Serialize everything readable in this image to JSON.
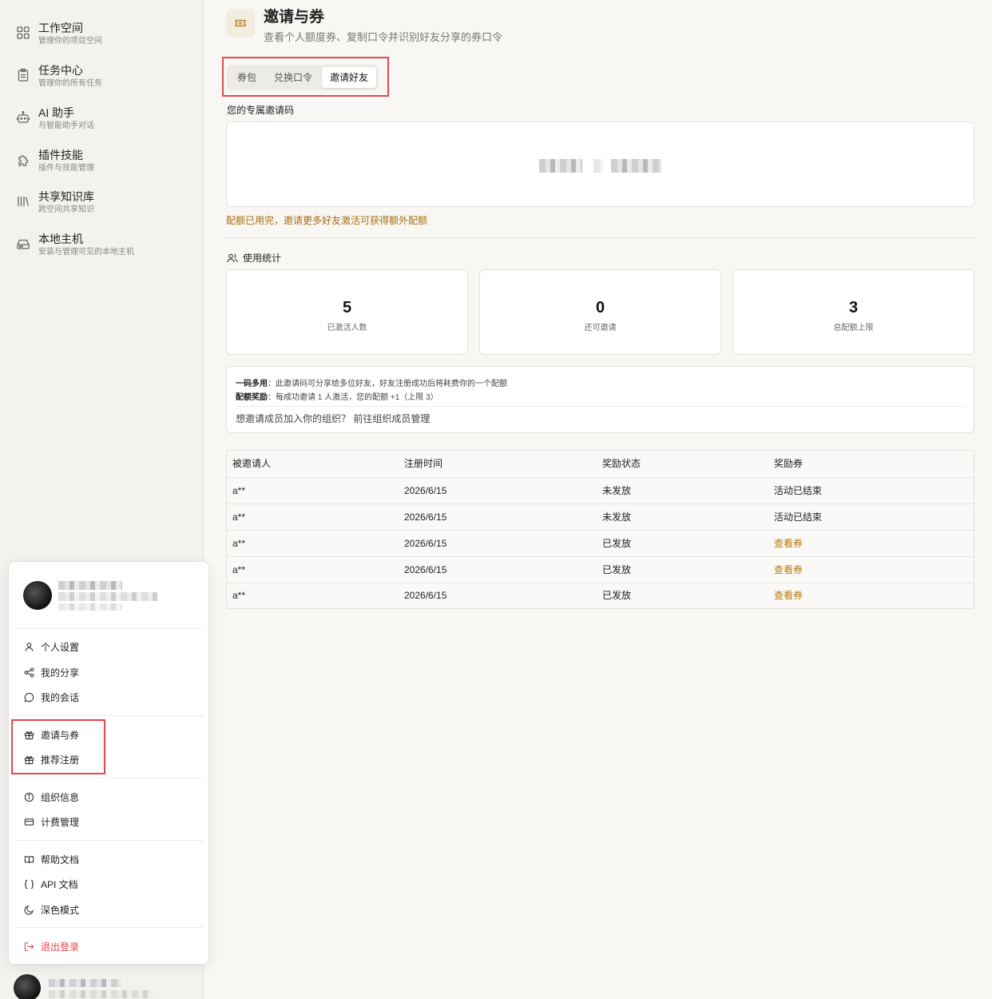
{
  "sidebar": {
    "items": [
      {
        "title": "工作空间",
        "sub": "管理你的项目空间",
        "icon": "grid-icon"
      },
      {
        "title": "任务中心",
        "sub": "管理你的所有任务",
        "icon": "clipboard-icon"
      },
      {
        "title": "AI 助手",
        "sub": "与智能助手对话",
        "icon": "bot-icon"
      },
      {
        "title": "插件技能",
        "sub": "插件与技能管理",
        "icon": "puzzle-icon"
      },
      {
        "title": "共享知识库",
        "sub": "跨空间共享知识",
        "icon": "library-icon"
      },
      {
        "title": "本地主机",
        "sub": "安装与管理可见的本地主机",
        "icon": "hard-drive-icon"
      }
    ]
  },
  "header": {
    "title": "邀请与券",
    "subtitle": "查看个人额度券、复制口令并识别好友分享的券口令"
  },
  "tabs": [
    {
      "label": "券包"
    },
    {
      "label": "兑换口令"
    },
    {
      "label": "邀请好友"
    }
  ],
  "invite": {
    "code_label": "您的专属邀请码",
    "quota_warning": "配额已用完，邀请更多好友激活可获得额外配额"
  },
  "stats": {
    "title": "使用统计",
    "cards": [
      {
        "value": "5",
        "label": "已激活人数"
      },
      {
        "value": "0",
        "label": "还可邀请"
      },
      {
        "value": "3",
        "label": "总配额上限"
      }
    ]
  },
  "info": {
    "line1_bold": "一码多用",
    "line1_text": "：此邀请码可分享给多位好友，好友注册成功后将耗费你的一个配额",
    "line2_bold": "配额奖励",
    "line2_text": "：每成功邀请 1 人激活，您的配额 +1（上限 3）",
    "link_text": "想邀请成员加入你的组织？ 前往组织成员管理"
  },
  "table": {
    "headers": [
      "被邀请人",
      "注册时间",
      "奖励状态",
      "奖励券"
    ],
    "rows": [
      [
        "a**",
        "2026/6/15",
        "未发放",
        "活动已结束"
      ],
      [
        "a**",
        "2026/6/15",
        "未发放",
        "活动已结束"
      ],
      [
        "a**",
        "2026/6/15",
        "已发放",
        "查看券"
      ],
      [
        "a**",
        "2026/6/15",
        "已发放",
        "查看券"
      ],
      [
        "a**",
        "2026/6/15",
        "已发放",
        "查看券"
      ]
    ]
  },
  "menu": {
    "group1": [
      {
        "label": "个人设置",
        "icon": "user-icon"
      },
      {
        "label": "我的分享",
        "icon": "share-icon"
      },
      {
        "label": "我的会话",
        "icon": "chat-bubble-icon"
      }
    ],
    "group2": [
      {
        "label": "邀请与券",
        "icon": "gift-icon"
      },
      {
        "label": "推荐注册",
        "icon": "gift-icon"
      }
    ],
    "group3": [
      {
        "label": "组织信息",
        "icon": "info-icon"
      },
      {
        "label": "计费管理",
        "icon": "credit-card-icon"
      }
    ],
    "group4": [
      {
        "label": "帮助文档",
        "icon": "book-icon"
      },
      {
        "label": "API 文档",
        "icon": "braces-icon"
      },
      {
        "label": "深色模式",
        "icon": "moon-icon"
      }
    ],
    "logout": {
      "label": "退出登录",
      "icon": "logout-icon"
    }
  },
  "colors": {
    "accent": "#b77a13",
    "warning_text": "#a66f10",
    "highlight_border": "#e5484d",
    "danger": "#e5484d"
  }
}
